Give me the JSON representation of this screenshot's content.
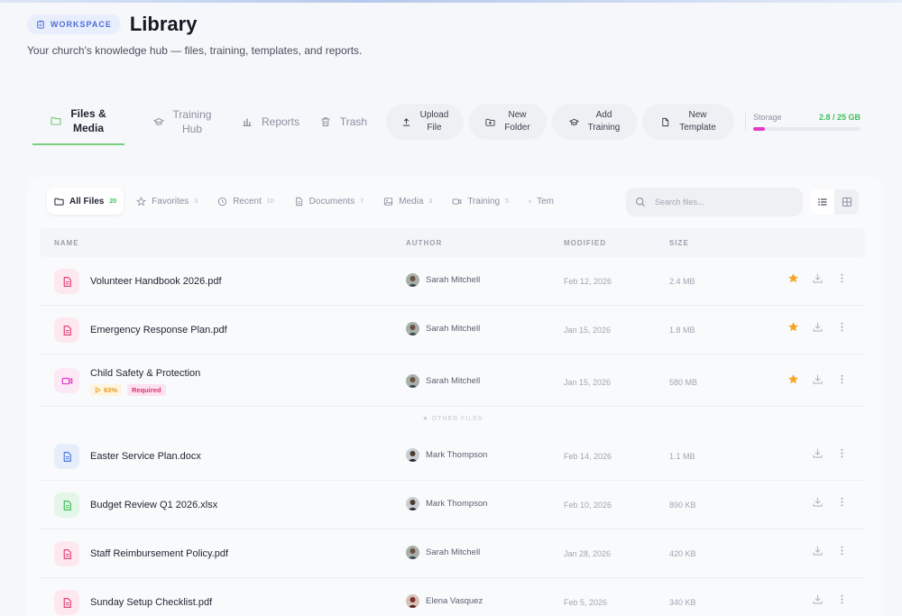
{
  "header": {
    "badge": "WORKSPACE",
    "title": "Library",
    "subtitle": "Your church's knowledge hub — files, training, templates, and reports."
  },
  "nav": {
    "tabs": [
      {
        "label": "Files &\nMedia",
        "icon": "folder-icon",
        "active": true
      },
      {
        "label": "Training\nHub",
        "icon": "graduation-cap-icon",
        "active": false
      },
      {
        "label": "Reports",
        "icon": "bar-chart-icon",
        "active": false
      },
      {
        "label": "Trash",
        "icon": "trash-icon",
        "active": false
      }
    ],
    "actions": [
      {
        "label": "Upload\nFile",
        "icon": "upload-icon"
      },
      {
        "label": "New\nFolder",
        "icon": "folder-plus-icon"
      },
      {
        "label": "Add\nTraining",
        "icon": "graduation-cap-icon"
      },
      {
        "label": "New\nTemplate",
        "icon": "file-icon"
      }
    ]
  },
  "storage": {
    "label": "Storage",
    "value": "2.8 / 25 GB",
    "used_fraction": 0.112,
    "bar_color": "#e33bc8"
  },
  "filters": [
    {
      "label": "All Files",
      "count": "20",
      "icon": "folder-icon",
      "active": true
    },
    {
      "label": "Favorites",
      "count": "3",
      "icon": "star-outline-icon"
    },
    {
      "label": "Recent",
      "count": "10",
      "icon": "clock-icon"
    },
    {
      "label": "Documents",
      "count": "7",
      "icon": "document-icon"
    },
    {
      "label": "Media",
      "count": "3",
      "icon": "image-icon"
    },
    {
      "label": "Training",
      "count": "5",
      "icon": "video-icon"
    },
    {
      "label": "Tem",
      "count": "",
      "icon": "file-icon"
    }
  ],
  "search": {
    "placeholder": "Search files..."
  },
  "table": {
    "columns": [
      "NAME",
      "AUTHOR",
      "MODIFIED",
      "SIZE"
    ],
    "divider_label": "OTHER FILES",
    "favorites": [
      {
        "name": "Volunteer Handbook 2026.pdf",
        "type": "pdf",
        "author": "Sarah Mitchell",
        "modified": "Feb 12, 2026",
        "size": "2.4 MB"
      },
      {
        "name": "Emergency Response Plan.pdf",
        "type": "pdf",
        "author": "Sarah Mitchell",
        "modified": "Jan 15, 2026",
        "size": "1.8 MB"
      },
      {
        "name": "Child Safety & Protection",
        "type": "video",
        "author": "Sarah Mitchell",
        "modified": "Jan 15, 2026",
        "size": "580 MB",
        "progress": "63%",
        "required": "Required"
      }
    ],
    "others": [
      {
        "name": "Easter Service Plan.docx",
        "type": "docx",
        "author": "Mark Thompson",
        "modified": "Feb 14, 2026",
        "size": "1.1 MB"
      },
      {
        "name": "Budget Review Q1 2026.xlsx",
        "type": "xlsx",
        "author": "Mark Thompson",
        "modified": "Feb 10, 2026",
        "size": "890 KB"
      },
      {
        "name": "Staff Reimbursement Policy.pdf",
        "type": "pdf",
        "author": "Sarah Mitchell",
        "modified": "Jan 28, 2026",
        "size": "420 KB"
      },
      {
        "name": "Sunday Setup Checklist.pdf",
        "type": "pdf",
        "author": "Elena Vasquez",
        "modified": "Feb 5, 2026",
        "size": "340 KB"
      }
    ]
  },
  "colors": {
    "accent_green": "#3fbf5a",
    "star": "#f5a623",
    "pdf": "#e0467c",
    "docx": "#4a7be0",
    "xlsx": "#3fbf5a",
    "video": "#e33bc8"
  }
}
